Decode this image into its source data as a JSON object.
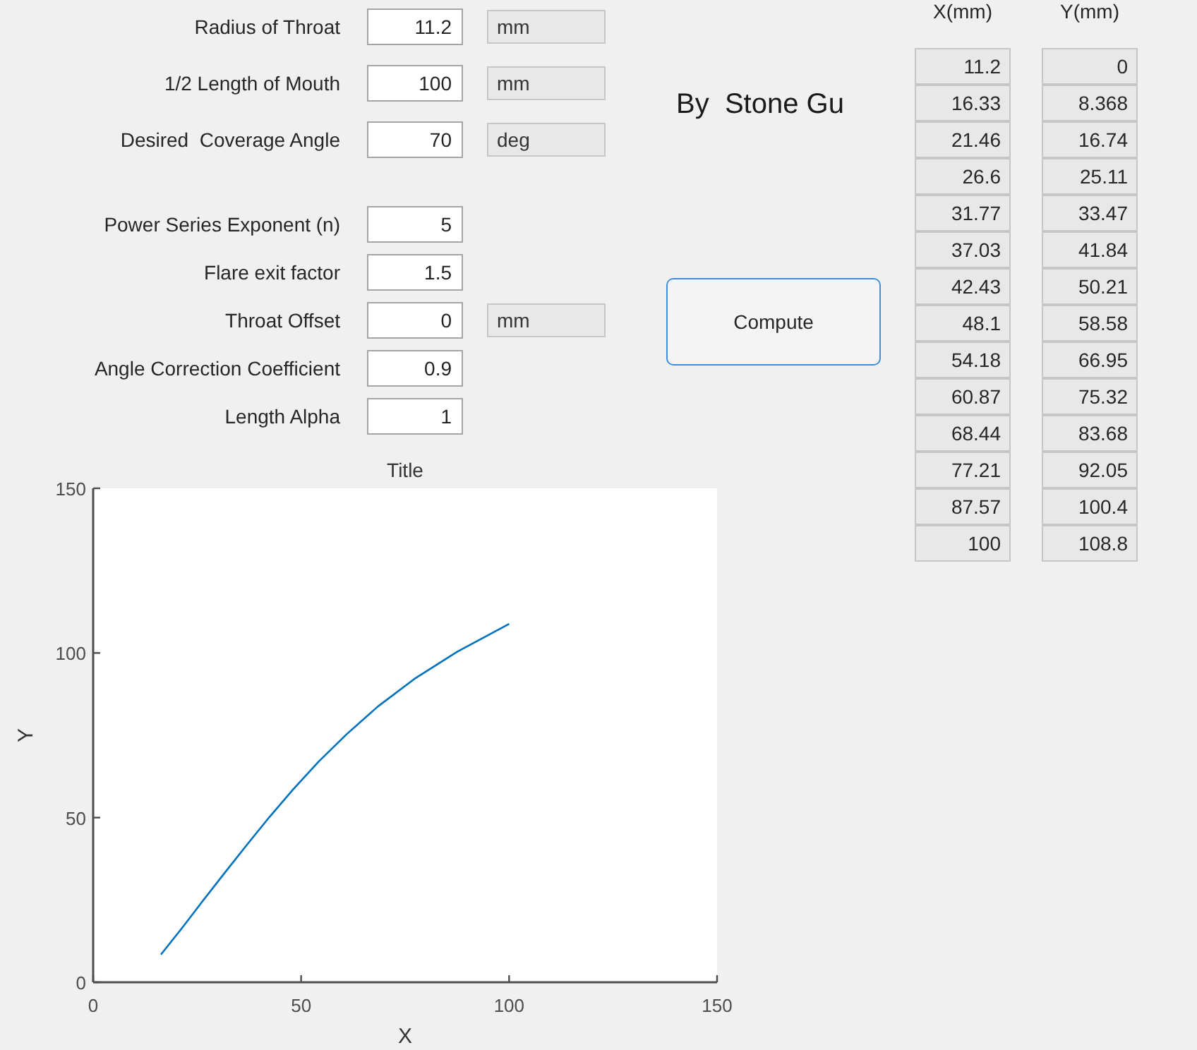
{
  "form": {
    "groups": [
      {
        "fields": [
          {
            "label": "Radius of Throat",
            "value": "11.2",
            "unit": "mm"
          },
          {
            "label": "1/2 Length of Mouth",
            "value": "100",
            "unit": "mm"
          },
          {
            "label": "Desired  Coverage Angle",
            "value": "70",
            "unit": "deg"
          }
        ]
      },
      {
        "fields": [
          {
            "label": "Power Series Exponent (n)",
            "value": "5"
          },
          {
            "label": "Flare exit factor",
            "value": "1.5"
          },
          {
            "label": "Throat Offset",
            "value": "0",
            "unit": "mm"
          },
          {
            "label": "Angle Correction Coefficient",
            "value": "0.9"
          },
          {
            "label": "Length Alpha",
            "value": "1"
          }
        ]
      }
    ]
  },
  "author": "By  Stone Gu",
  "compute_button": {
    "label": "Compute"
  },
  "table": {
    "columns": [
      "X(mm)",
      "Y(mm)"
    ],
    "rows": [
      [
        "11.2",
        "0"
      ],
      [
        "16.33",
        "8.368"
      ],
      [
        "21.46",
        "16.74"
      ],
      [
        "26.6",
        "25.11"
      ],
      [
        "31.77",
        "33.47"
      ],
      [
        "37.03",
        "41.84"
      ],
      [
        "42.43",
        "50.21"
      ],
      [
        "48.1",
        "58.58"
      ],
      [
        "54.18",
        "66.95"
      ],
      [
        "60.87",
        "75.32"
      ],
      [
        "68.44",
        "83.68"
      ],
      [
        "77.21",
        "92.05"
      ],
      [
        "87.57",
        "100.4"
      ],
      [
        "100",
        "108.8"
      ]
    ]
  },
  "plot": {
    "chart_data": {
      "type": "line",
      "title": "Title",
      "xlabel": "X",
      "ylabel": "Y",
      "x": [
        16.3,
        21.5,
        26.6,
        31.8,
        37,
        42.4,
        48.1,
        54.2,
        60.9,
        68.4,
        77.2,
        87.6,
        100
      ],
      "series": [
        {
          "color": "#0072bd",
          "values": [
            8.4,
            16.7,
            25.1,
            33.5,
            41.8,
            50.2,
            58.6,
            67,
            75.3,
            83.7,
            92.1,
            100.4,
            108.8
          ]
        }
      ],
      "xlim": [
        0,
        150
      ],
      "ylim": [
        0,
        150
      ],
      "xticks": [
        0,
        50,
        100,
        150
      ],
      "yticks": [
        0,
        50,
        100,
        150
      ]
    }
  }
}
